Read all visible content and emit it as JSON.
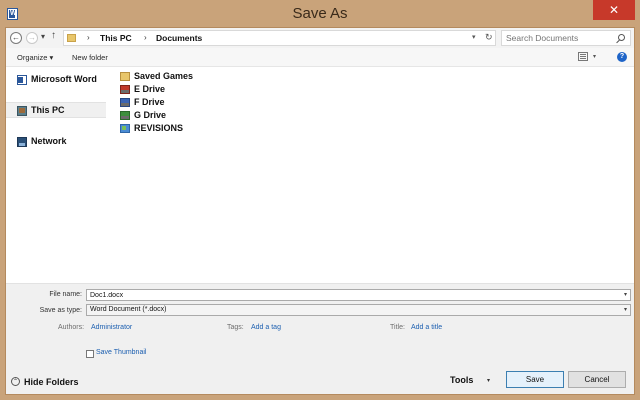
{
  "window": {
    "title": "Save As",
    "app_icon_letter": "W",
    "close_glyph": "✕"
  },
  "address": {
    "crumbs": [
      "This PC",
      "Documents"
    ],
    "search_placeholder": "Search Documents",
    "back_glyph": "←",
    "forward_glyph": "→",
    "up_glyph": "↑",
    "recent_glyph": "▾",
    "sep_glyph": "›",
    "drop_glyph": "▾",
    "refresh_glyph": "↻"
  },
  "toolbar": {
    "organize": "Organize ▾",
    "new_folder": "New folder",
    "help": "?",
    "view_drop": "▾"
  },
  "nav": {
    "items": [
      {
        "label": "Microsoft Word",
        "icon": "word-icon"
      },
      {
        "label": "This PC",
        "icon": "computer-icon",
        "selected": true
      },
      {
        "label": "Network",
        "icon": "network-icon"
      }
    ]
  },
  "files": [
    {
      "label": "Saved Games",
      "icon": "folder-icon"
    },
    {
      "label": "E Drive",
      "icon": "drive-icon"
    },
    {
      "label": "F Drive",
      "icon": "drive-icon"
    },
    {
      "label": "G Drive",
      "icon": "drive-icon"
    },
    {
      "label": "REVISIONS",
      "icon": "folder-icon"
    }
  ],
  "details": {
    "file_name_label": "File name:",
    "file_name_value": "Doc1.docx",
    "save_type_label": "Save as type:",
    "save_type_value": "Word Document (*.docx)",
    "authors_label": "Authors:",
    "authors_value": "Administrator",
    "tags_label": "Tags:",
    "tags_value": "Add a tag",
    "title_label": "Title:",
    "title_value": "Add a title",
    "thumbnail_label": "Save Thumbnail",
    "drop_glyph": "▾"
  },
  "footer": {
    "hide_folders": "Hide Folders",
    "hide_glyph": "⌃",
    "tools": "Tools",
    "tools_drop": "▾",
    "save": "Save",
    "cancel": "Cancel"
  },
  "colors": {
    "frame": "#c9a37a",
    "close": "#c7392a",
    "link": "#1c5fb0",
    "primary_border": "#3c7fb1"
  }
}
